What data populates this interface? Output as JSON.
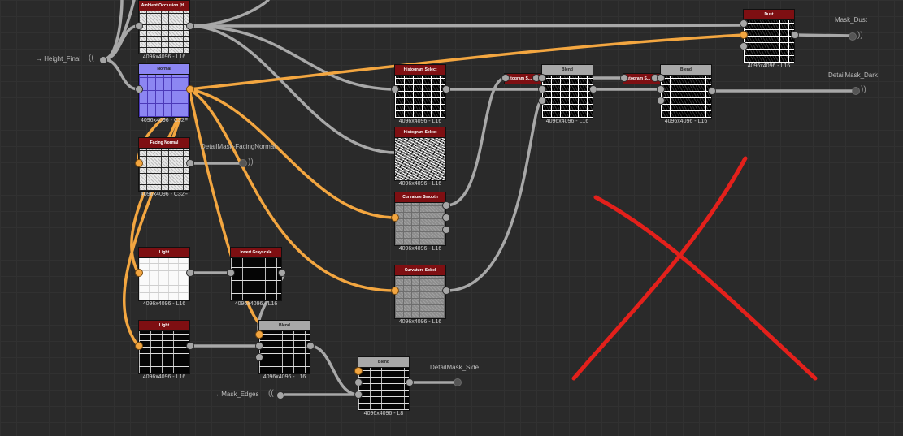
{
  "graph": {
    "nodes": {
      "ambient_occlusion": {
        "title": "Ambient Occlusion (H...",
        "resolution": "4096x4096 - L16"
      },
      "normal": {
        "title": "Normal",
        "resolution": "4096x4096 - C32F"
      },
      "facing_normal": {
        "title": "Facing Normal",
        "resolution": "4096x4096 - C32F"
      },
      "light_1": {
        "title": "Light",
        "resolution": "4096x4096 - L16"
      },
      "invert_grayscale": {
        "title": "Invert Grayscale",
        "resolution": "4096x4096 - L16"
      },
      "light_2": {
        "title": "Light",
        "resolution": "4096x4096 - L16"
      },
      "blend_1": {
        "title": "Blend",
        "resolution": "4096x4096 - L16"
      },
      "blend_2": {
        "title": "Blend",
        "resolution": "4096x4096 - L8"
      },
      "histogram_select_1": {
        "title": "Histogram Select",
        "resolution": "4096x4096 - L16"
      },
      "histogram_select_2": {
        "title": "Histogram Select",
        "resolution": "4096x4096 - L16"
      },
      "curvature_smooth": {
        "title": "Curvature Smooth",
        "resolution": "4096x4096 - L16"
      },
      "curvature_sobel": {
        "title": "Curvature Sobel",
        "resolution": "4096x4096 - L16"
      },
      "blend_3": {
        "title": "Blend",
        "resolution": "4096x4096 - L16"
      },
      "blend_4": {
        "title": "Blend",
        "resolution": "4096x4096 - L16"
      },
      "dust": {
        "title": "Dust",
        "resolution": "4096x4096 - L16"
      }
    },
    "tags": {
      "histogram_s_1": "istogram S...",
      "histogram_s_2": "istogram S..."
    },
    "inputs": {
      "height_final": "→ Height_Final",
      "mask_edges": "→ Mask_Edges"
    },
    "outputs": {
      "mask_dust": "Mask_Dust",
      "detailmask_dark": "DetailMask_Dark",
      "detailmask_facingnormal": "DetailMask-FacingNormal",
      "detailmask_side": "DetailMask_Side"
    }
  },
  "colors": {
    "background": "#2a2a2a",
    "wire_grey": "#a8a8a8",
    "wire_orange": "#f3a640",
    "header_red": "#7e0f12",
    "header_grey": "#a8a8a8",
    "annotation_red": "#e3201b"
  },
  "icons": [
    "output-signal-icon",
    "input-signal-icon"
  ],
  "annotation": {
    "type": "red-x-mark"
  }
}
